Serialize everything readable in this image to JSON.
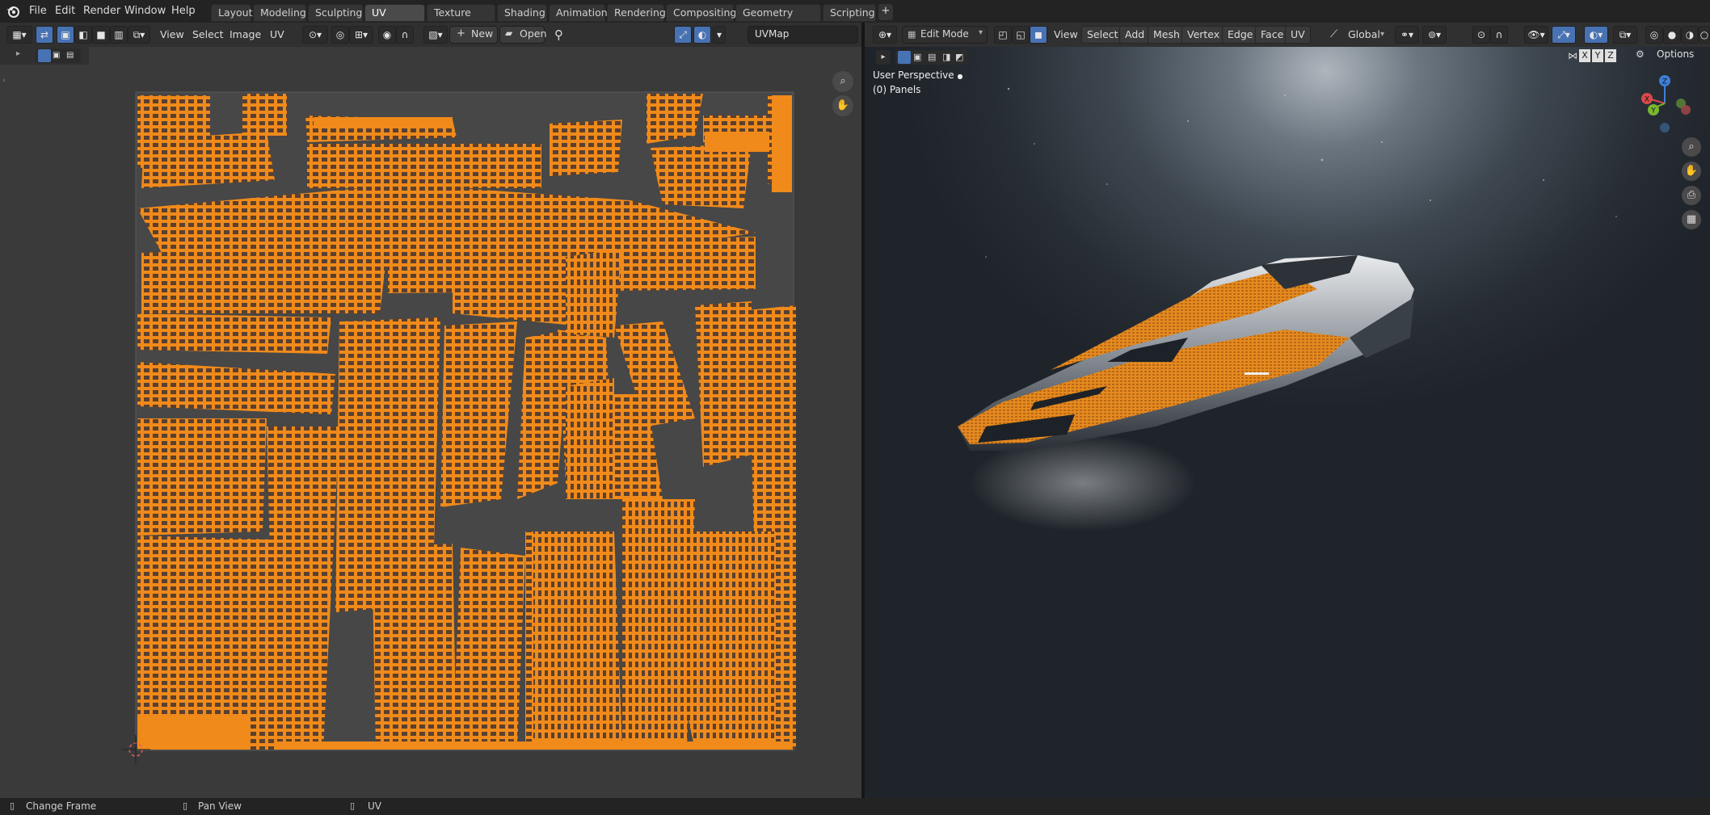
{
  "menus": [
    "File",
    "Edit",
    "Render",
    "Window",
    "Help"
  ],
  "workspaces": [
    "Layout",
    "Modeling",
    "Sculpting",
    "UV Editing",
    "Texture Paint",
    "Shading",
    "Animation",
    "Rendering",
    "Compositing",
    "Geometry Nodes",
    "Scripting"
  ],
  "active_workspace": "UV Editing",
  "uv_header": {
    "menus": [
      "View",
      "Select",
      "Image",
      "UV"
    ],
    "new_label": "New",
    "open_label": "Open",
    "uvmap_name": "UVMap"
  },
  "vp_header": {
    "mode": "Edit Mode",
    "menus": [
      "View",
      "Select",
      "Add",
      "Mesh",
      "Vertex",
      "Edge",
      "Face",
      "UV"
    ],
    "orientation": "Global",
    "options_label": "Options",
    "axis_x": "X",
    "axis_y": "Y",
    "axis_z": "Z"
  },
  "viewport": {
    "perspective_label": "User Perspective",
    "object_label": "(0) Panels"
  },
  "gizmo": {
    "x": "X",
    "y": "Y",
    "z": "Z"
  },
  "status": {
    "left": "Change Frame",
    "mid": "Pan View",
    "right": "UV"
  },
  "colors": {
    "accent": "#4772b3",
    "uv_orange": "#f08a1a",
    "uv_dark": "#5a4030"
  }
}
